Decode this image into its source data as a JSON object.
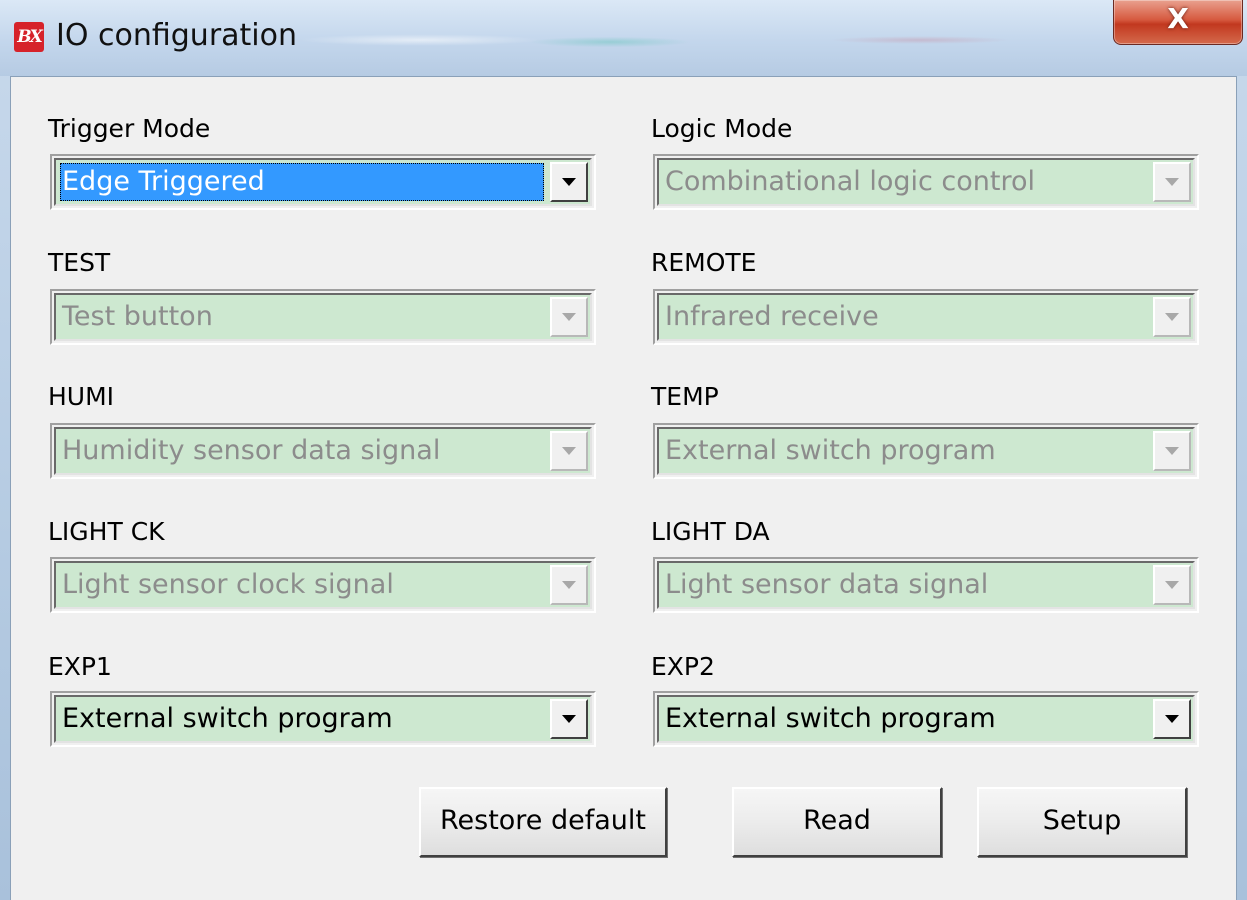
{
  "window": {
    "title": "IO configuration",
    "logo_text": "BX",
    "close_label": "X"
  },
  "fields": {
    "trigger_mode": {
      "label": "Trigger Mode",
      "value": "Edge Triggered",
      "enabled": true,
      "selected": true
    },
    "logic_mode": {
      "label": "Logic Mode",
      "value": "Combinational logic control",
      "enabled": false
    },
    "test": {
      "label": "TEST",
      "value": "Test button",
      "enabled": false
    },
    "remote": {
      "label": "REMOTE",
      "value": "Infrared receive",
      "enabled": false
    },
    "humi": {
      "label": "HUMI",
      "value": "Humidity sensor data signal",
      "enabled": false
    },
    "temp": {
      "label": "TEMP",
      "value": "External switch program",
      "enabled": false
    },
    "light_ck": {
      "label": "LIGHT CK",
      "value": "Light sensor clock signal",
      "enabled": false
    },
    "light_da": {
      "label": "LIGHT DA",
      "value": "Light sensor data signal",
      "enabled": false
    },
    "exp1": {
      "label": "EXP1",
      "value": "External switch program",
      "enabled": true
    },
    "exp2": {
      "label": "EXP2",
      "value": "External switch program",
      "enabled": true
    }
  },
  "buttons": {
    "restore_default": "Restore default",
    "read": "Read",
    "setup": "Setup"
  },
  "colors": {
    "combo_background": "#cde8d0",
    "selection_highlight": "#3399ff",
    "disabled_text": "#8c8c8c",
    "close_button": "#c2381f"
  }
}
